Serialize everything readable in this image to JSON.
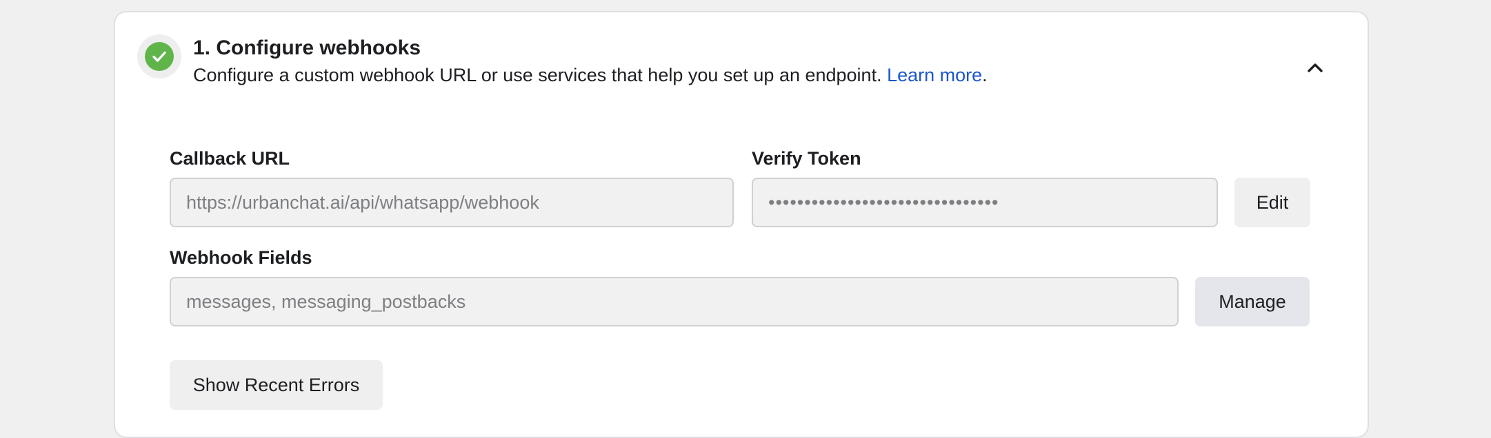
{
  "section": {
    "title": "1. Configure webhooks",
    "description": "Configure a custom webhook URL or use services that help you set up an endpoint.",
    "learn_more": "Learn more",
    "trailing_period": ".",
    "status_icon": "check-circle-icon",
    "collapse_icon": "chevron-up-icon"
  },
  "callback_url": {
    "label": "Callback URL",
    "value": "https://urbanchat.ai/api/whatsapp/webhook"
  },
  "verify_token": {
    "label": "Verify Token",
    "value": "••••••••••••••••••••••••••••••••",
    "edit_label": "Edit"
  },
  "webhook_fields": {
    "label": "Webhook Fields",
    "value": "messages, messaging_postbacks",
    "manage_label": "Manage"
  },
  "show_errors_label": "Show Recent Errors",
  "colors": {
    "success": "#5fb54a",
    "link": "#1a56c8"
  }
}
